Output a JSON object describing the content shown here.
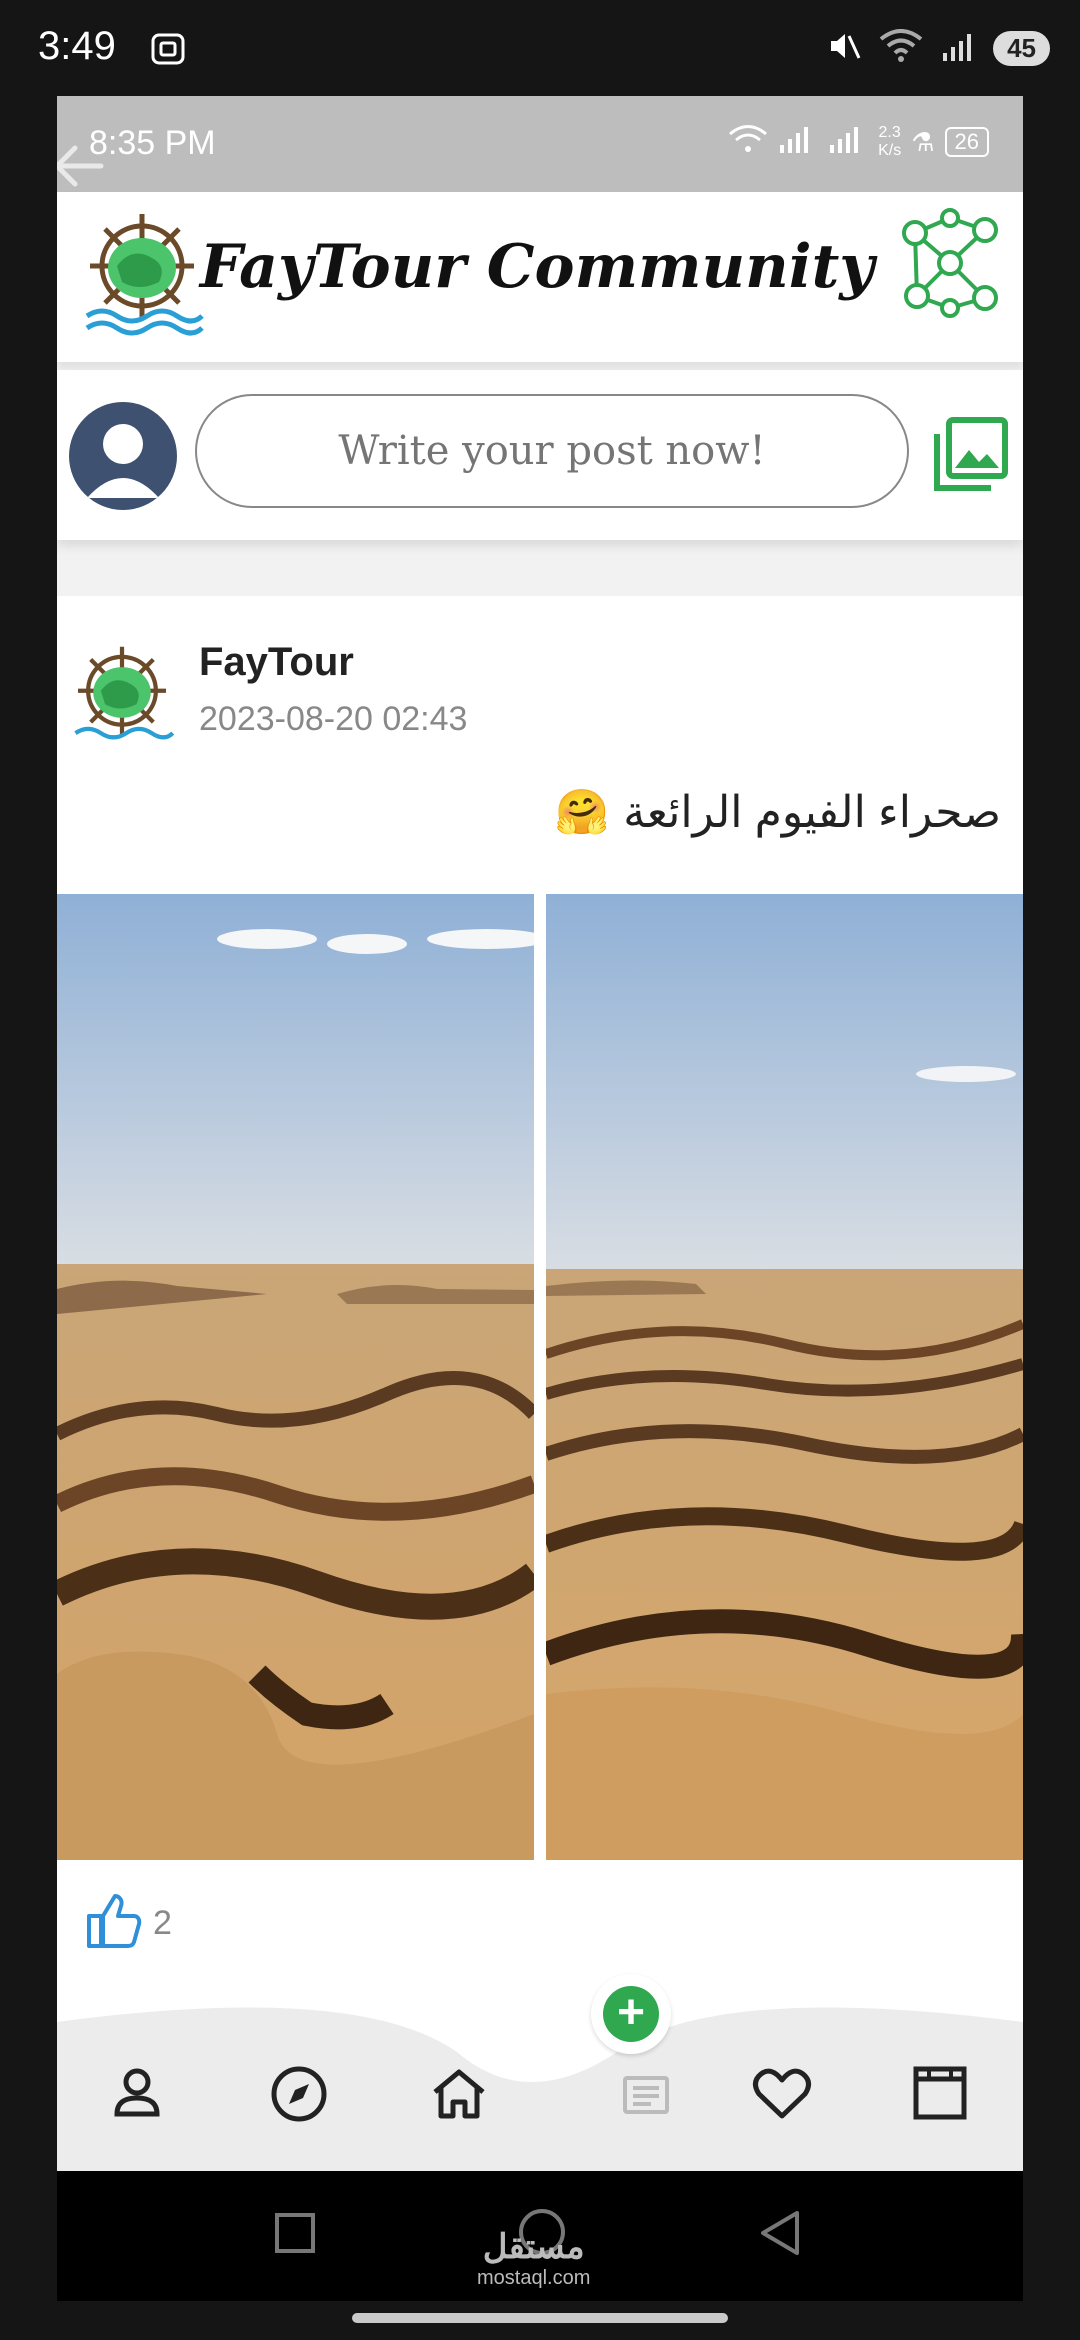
{
  "outer_status": {
    "time": "3:49",
    "battery": "45"
  },
  "inner_status": {
    "time": "8:35 PM",
    "speed_top": "2.3",
    "speed_unit": "K/s",
    "battery": "26"
  },
  "header": {
    "title": "FayTour Community"
  },
  "composer": {
    "placeholder": "Write your post now!"
  },
  "post": {
    "author": "FayTour",
    "date": "2023-08-20 02:43",
    "text": "صحراء الفيوم الرائعة",
    "emoji": "🤗",
    "like_count": "2"
  },
  "bottom_nav": {
    "items": [
      "profile-icon",
      "compass-icon",
      "home-icon",
      "plus-icon",
      "heart-icon",
      "window-icon"
    ]
  },
  "watermark": {
    "arabic": "مستقل",
    "latin": "mostaql.com"
  },
  "colors": {
    "accent_green": "#2fa84f",
    "like_blue": "#2f8fd8",
    "avatar_blue": "#3e5170"
  }
}
